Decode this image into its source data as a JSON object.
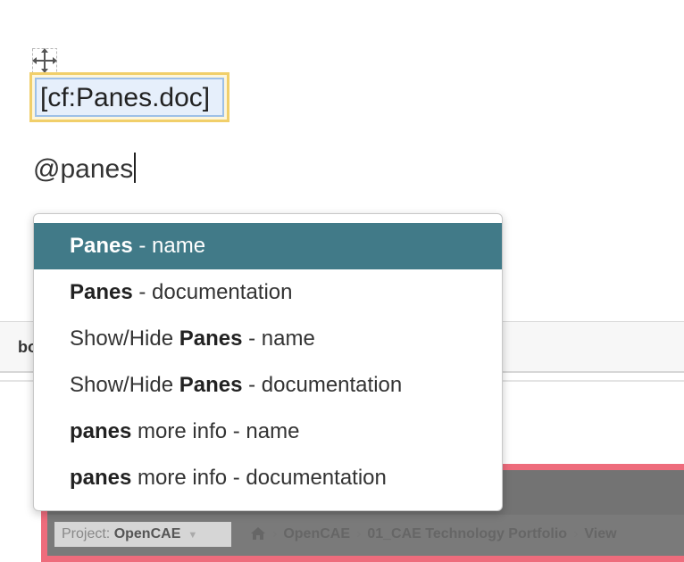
{
  "editor": {
    "move_handle_icon": "move-arrows-icon",
    "xref_chip_text": "[cf:Panes.doc]",
    "mention_text": "@panes"
  },
  "autocomplete": {
    "items": [
      {
        "prefix": "",
        "bold": "Panes",
        "suffix": " - name",
        "active": true
      },
      {
        "prefix": "",
        "bold": "Panes",
        "suffix": " - documentation",
        "active": false
      },
      {
        "prefix": "Show/Hide ",
        "bold": "Panes",
        "suffix": " - name",
        "active": false
      },
      {
        "prefix": "Show/Hide ",
        "bold": "Panes",
        "suffix": " - documentation",
        "active": false
      },
      {
        "prefix": "",
        "bold": "panes",
        "suffix": " more info - name",
        "active": false
      },
      {
        "prefix": "",
        "bold": "panes",
        "suffix": " more info - documentation",
        "active": false
      }
    ]
  },
  "background": {
    "toolbar_partial_text": "bo",
    "project_label": "Project: ",
    "project_value": "OpenCAE",
    "breadcrumb": [
      "OpenCAE",
      "01_CAE Technology Portfolio",
      "View"
    ]
  },
  "colors": {
    "active_item_bg": "#417a88",
    "chip_outer_border": "#f1cf6a",
    "chip_inner_border": "#9dc0e8",
    "embed_frame_border": "#ee6c7c"
  }
}
